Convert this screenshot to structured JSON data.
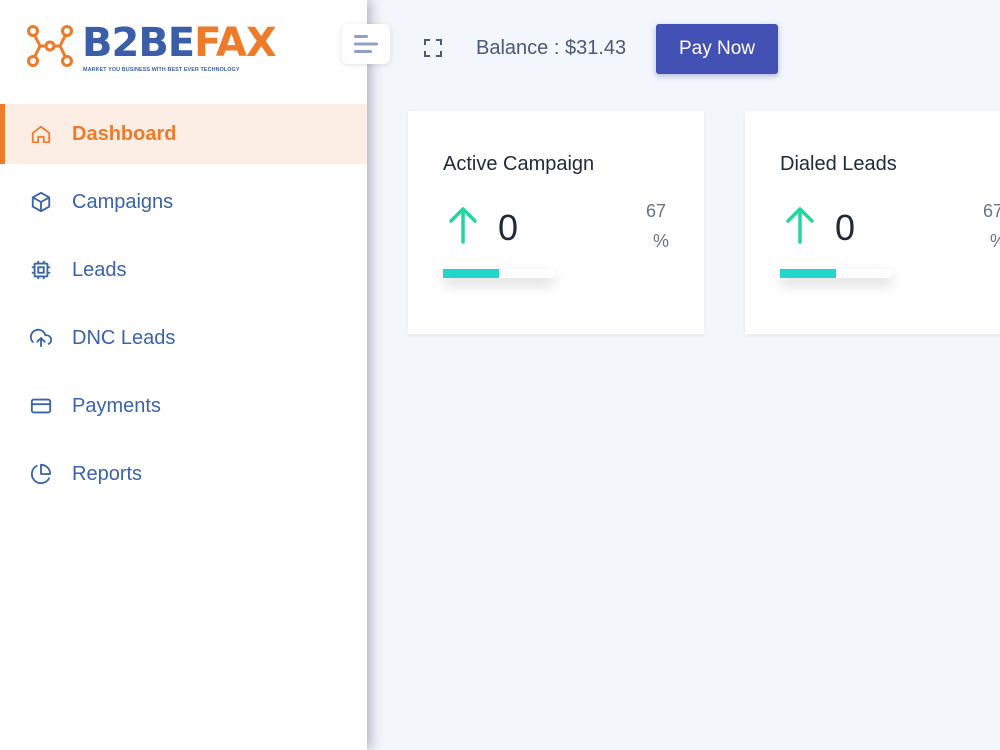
{
  "brand": {
    "logo_b2b": "B2BE",
    "logo_fax": "FAX",
    "tagline": "MARKET YOU BUSINESS WITH BEST EVER TECHNOLOGY",
    "primary_color": "#3a5fa8",
    "accent_color": "#ee7b2a"
  },
  "sidebar": {
    "items": [
      {
        "label": "Dashboard",
        "icon": "home-icon",
        "active": true
      },
      {
        "label": "Campaigns",
        "icon": "cube-icon",
        "active": false
      },
      {
        "label": "Leads",
        "icon": "chip-icon",
        "active": false
      },
      {
        "label": "DNC Leads",
        "icon": "cloud-upload-icon",
        "active": false
      },
      {
        "label": "Payments",
        "icon": "credit-card-icon",
        "active": false
      },
      {
        "label": "Reports",
        "icon": "pie-chart-icon",
        "active": false
      }
    ]
  },
  "header": {
    "balance_text": "Balance : $31.43",
    "pay_button_label": "Pay Now"
  },
  "cards": [
    {
      "title": "Active Campaign",
      "value": "0",
      "percent": "67",
      "percent_sign": "%",
      "progress_fraction": 0.5
    },
    {
      "title": "Dialed Leads",
      "value": "0",
      "percent": "67",
      "percent_sign": "%",
      "progress_fraction": 0.5
    }
  ],
  "colors": {
    "arrow": "#22d6a0",
    "progress": "#22d6cc",
    "pay_button": "#4350b4"
  }
}
